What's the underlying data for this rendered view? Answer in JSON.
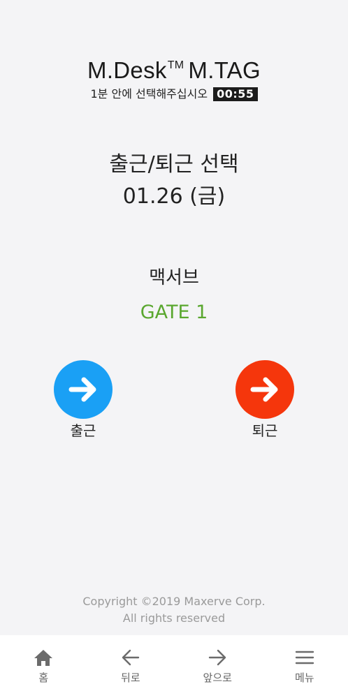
{
  "header": {
    "brand": "M.Desk",
    "tm": "TM",
    "product": "M.TAG",
    "instruction": "1분 안에 선택해주십시오",
    "countdown": "00:55"
  },
  "selection": {
    "title": "출근/퇴근 선택",
    "date": "01.26 (금)"
  },
  "location": {
    "name": "맥서브",
    "gate": "GATE 1",
    "gate_color": "#5aa72f"
  },
  "actions": [
    {
      "label": "출근",
      "icon": "arrow-right-icon",
      "color": "#1aa0f5"
    },
    {
      "label": "퇴근",
      "icon": "arrow-right-icon",
      "color": "#f5360c"
    }
  ],
  "footer": {
    "copyright": "Copyright ©2019 Maxerve Corp.",
    "rights": "All rights reserved"
  },
  "nav": [
    {
      "label": "홈",
      "icon": "home-icon"
    },
    {
      "label": "뒤로",
      "icon": "arrow-left-icon"
    },
    {
      "label": "앞으로",
      "icon": "arrow-right-icon"
    },
    {
      "label": "메뉴",
      "icon": "menu-icon"
    }
  ]
}
